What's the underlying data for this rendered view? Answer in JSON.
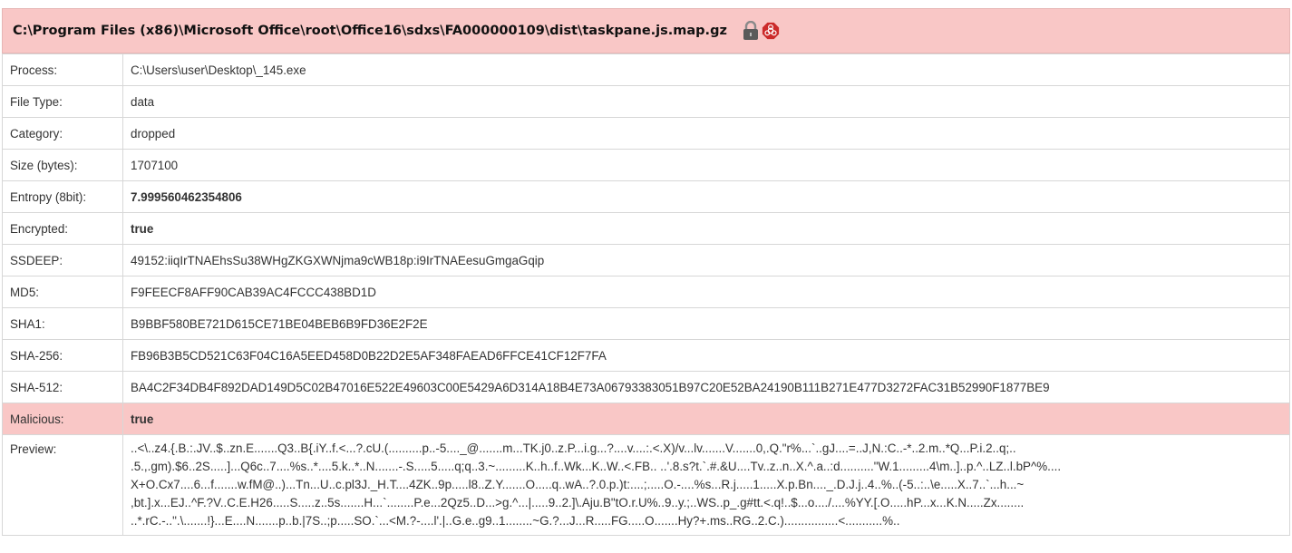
{
  "header": {
    "title": "C:\\Program Files (x86)\\Microsoft Office\\root\\Office16\\sdxs\\FA000000109\\dist\\taskpane.js.map.gz",
    "icons": [
      "lock-icon",
      "biohazard-icon"
    ]
  },
  "rows": {
    "process": {
      "label": "Process:",
      "value": "C:\\Users\\user\\Desktop\\_145.exe"
    },
    "file_type": {
      "label": "File Type:",
      "value": "data"
    },
    "category": {
      "label": "Category:",
      "value": "dropped"
    },
    "size": {
      "label": "Size (bytes):",
      "value": "1707100"
    },
    "entropy": {
      "label": "Entropy (8bit):",
      "value": "7.999560462354806"
    },
    "encrypted": {
      "label": "Encrypted:",
      "value": "true"
    },
    "ssdeep": {
      "label": "SSDEEP:",
      "value": "49152:iiqIrTNAEhsSu38WHgZKGXWNjma9cWB18p:i9IrTNAEesuGmgaGqip"
    },
    "md5": {
      "label": "MD5:",
      "value": "F9FEECF8AFF90CAB39AC4FCCC438BD1D"
    },
    "sha1": {
      "label": "SHA1:",
      "value": "B9BBF580BE721D615CE71BE04BEB6B9FD36E2F2E"
    },
    "sha256": {
      "label": "SHA-256:",
      "value": "FB96B3B5CD521C63F04C16A5EED458D0B22D2E5AF348FAEAD6FFCE41CF12F7FA"
    },
    "sha512": {
      "label": "SHA-512:",
      "value": "BA4C2F34DB4F892DAD149D5C02B47016E522E49603C00E5429A6D314A18B4E73A06793383051B97C20E52BA24190B111B271E477D3272FAC31B52990F1877BE9"
    },
    "malicious": {
      "label": "Malicious:",
      "value": "true"
    },
    "preview": {
      "label": "Preview:",
      "lines": [
        "..<\\..z4.{.B.:.JV..$..zn.E.......Q3..B{.iY..f.<...?.cU.(..........p..-5...._@.......m...TK.j0..z.P...i.g...?....v....:.<.X)/v...lv.......V.......0,.Q.\"r%...`..gJ....=..J,N.:C..-*..2.m..*Q...P.i.2..q;..",
        ".5.,.gm).$6..2S.....]...Q6c..7....%s..*....5.k..*..N.......-.S.....5.....q;q..3.~.........K..h..f..Wk...K..W..<.FB.. ..'.8.s?t.`.#.&U....Tv..z..n..X.^.a..:d..........\"W.1.........4\\m..]..p.^..LZ..l.bP^%....",
        "X+O.Cx7....6...f.......w.fM@..)...Tn...U..c.pl3J._H.T....4ZK..9p.....l8..Z.Y.......O.....q..wA..?.0.p.)t:....;.....O.-....%s...R.j.....1.....X.p.Bn...._.D.J.j..4..%..(-5..:..\\e.....X..7..`...h...~",
        ",bt.].x...EJ..^F.?V..C.E.H26.....S.....z..5s.......H...`........P.e...2Qz5..D...>g.^...|.....9..2.]\\.Aju.B\"tO.r.U%..9..y.;..WS..p_.g#tt.<.q!..$...o..../....%YY.[.O.....hP...x...K.N.....Zx........",
        "..*.rC.-..\".\\.......!}...E....N.......p..b.|7S..;p.....SO.`...<M.?-....l'.|..G.e..g9..1........~G.?...J...R.....FG.....O.......Hy?+.ms..RG..2.C.)................<...........%.."
      ]
    }
  },
  "colors": {
    "accent_bg": "#f9c7c6",
    "border": "#d7d7d7"
  }
}
